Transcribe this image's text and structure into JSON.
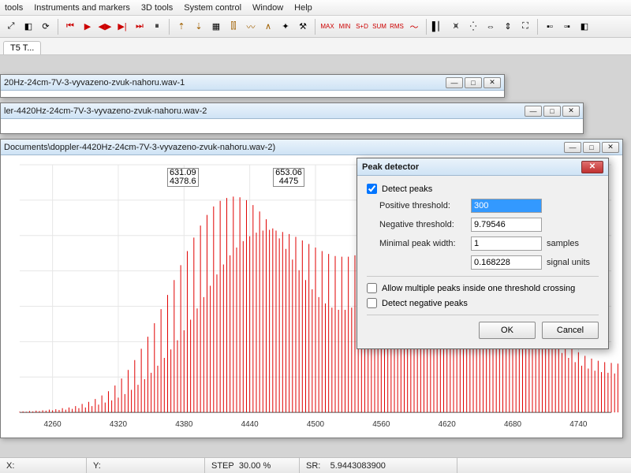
{
  "menu": [
    "tools",
    "Instruments and markers",
    "3D tools",
    "System control",
    "Window",
    "Help"
  ],
  "tabs": [
    "T5  T..."
  ],
  "windows": [
    {
      "title": "20Hz-24cm-7V-3-vyvazeno-zvuk-nahoru.wav-1"
    },
    {
      "title": "ler-4420Hz-24cm-7V-3-vyvazeno-zvuk-nahoru.wav-2"
    },
    {
      "title": "Documents\\doppler-4420Hz-24cm-7V-3-vyvazeno-zvuk-nahoru.wav-2)"
    }
  ],
  "peaks": [
    {
      "x": 4378.6,
      "v1": "631.09",
      "v2": "4378.6"
    },
    {
      "x": 4475,
      "v1": "653.06",
      "v2": "4475"
    }
  ],
  "dialog": {
    "title": "Peak detector",
    "detect_peaks": "Detect peaks",
    "pos_thr_label": "Positive threshold:",
    "pos_thr_value": "300",
    "neg_thr_label": "Negative threshold:",
    "neg_thr_value": "9.79546",
    "min_w_label": "Minimal peak width:",
    "min_w_samples": "1",
    "min_w_units": "0.168228",
    "samples": "samples",
    "signal_units": "signal units",
    "allow_multi": "Allow multiple peaks inside one threshold crossing",
    "detect_neg": "Detect negative peaks",
    "ok": "OK",
    "cancel": "Cancel"
  },
  "status": {
    "x_label": "X:",
    "y_label": "Y:",
    "step_label": "STEP",
    "step_value": "30.00 %",
    "sr_label": "SR:",
    "sr_value": "5.9443083900"
  },
  "chart_data": {
    "type": "line",
    "title": "",
    "xlabel": "",
    "ylabel": "",
    "xlim": [
      4230,
      4770
    ],
    "ylim": [
      0,
      700
    ],
    "xticks": [
      4260,
      4320,
      4380,
      4440,
      4500,
      4560,
      4620,
      4680,
      4740
    ],
    "series": [
      {
        "name": "signal",
        "color": "#e00000",
        "x_step": 3,
        "x_start": 4230,
        "values": [
          2,
          3,
          2,
          4,
          3,
          5,
          4,
          6,
          5,
          8,
          6,
          9,
          7,
          12,
          8,
          14,
          10,
          18,
          12,
          24,
          14,
          30,
          18,
          38,
          22,
          48,
          28,
          60,
          34,
          76,
          42,
          96,
          52,
          120,
          64,
          148,
          78,
          180,
          94,
          214,
          112,
          252,
          132,
          292,
          154,
          332,
          178,
          374,
          204,
          416,
          232,
          456,
          262,
          494,
          294,
          528,
          326,
          558,
          358,
          582,
          390,
          598,
          418,
          606,
          444,
          610,
          466,
          608,
          484,
          600,
          498,
          586,
          508,
          568,
          514,
          546,
          516,
          520,
          514,
          492,
          510,
          462,
          504,
          432,
          496,
          402,
          486,
          374,
          476,
          348,
          466,
          326,
          456,
          308,
          448,
          296,
          442,
          290,
          440,
          290,
          440,
          296,
          444,
          308,
          452,
          326,
          462,
          350,
          476,
          378,
          492,
          410,
          510,
          444,
          528,
          478,
          546,
          510,
          564,
          538,
          580,
          560,
          594,
          576,
          604,
          584,
          610,
          586,
          610,
          580,
          604,
          568,
          594,
          552,
          580,
          532,
          562,
          510,
          540,
          486,
          516,
          460,
          490,
          432,
          462,
          404,
          434,
          376,
          406,
          348,
          378,
          320,
          350,
          294,
          322,
          268,
          296,
          244,
          272,
          222,
          250,
          202,
          230,
          184,
          212,
          168,
          196,
          154,
          182,
          142,
          170,
          132,
          160,
          124,
          152,
          118,
          146,
          114,
          142,
          112,
          140,
          110,
          138,
          108,
          134,
          104,
          128,
          98,
          120,
          90,
          110,
          80,
          98,
          70,
          86,
          60,
          74,
          50,
          62,
          42,
          52,
          34,
          42,
          28,
          34,
          22,
          28,
          18,
          22,
          14,
          18,
          12,
          14,
          10,
          12,
          8,
          10,
          7,
          8,
          6,
          7,
          5,
          6,
          4,
          5,
          4,
          4,
          3,
          4,
          3,
          3
        ]
      }
    ]
  }
}
